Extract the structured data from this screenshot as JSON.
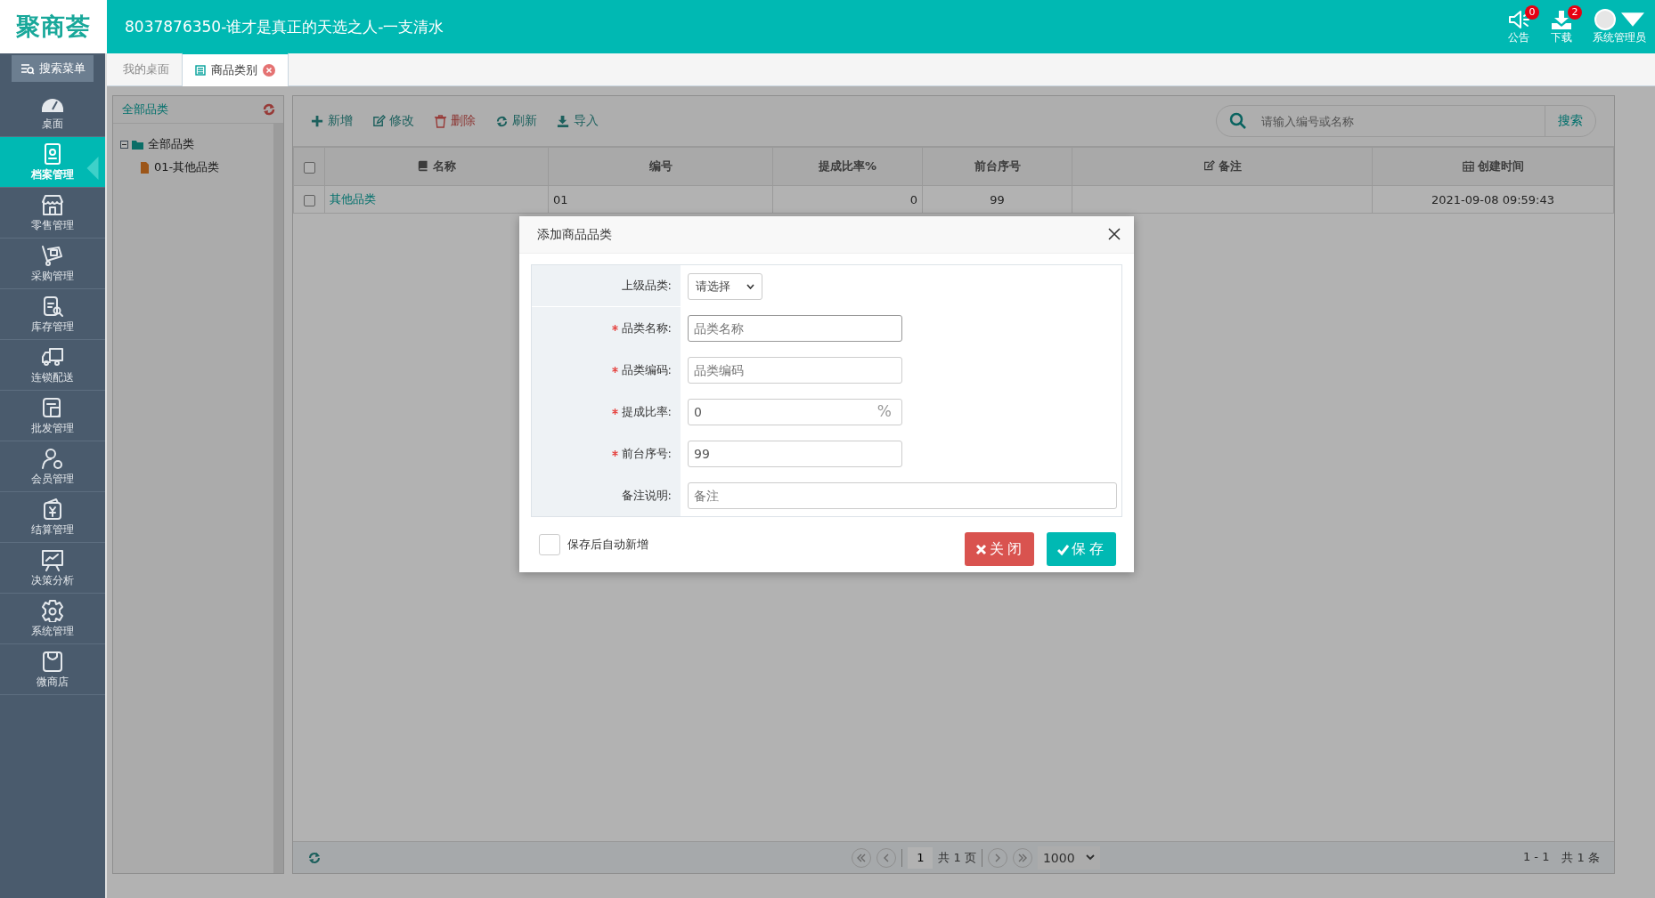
{
  "app": {
    "logo": "聚商荟",
    "title": "8037876350-谁才是真正的天选之人-一支清水"
  },
  "top_actions": [
    {
      "kind": "notice",
      "label": "公告",
      "badge": "0"
    },
    {
      "kind": "download",
      "label": "下载",
      "badge": "2"
    },
    {
      "kind": "user",
      "label": "系统管理员"
    }
  ],
  "sidebar": {
    "search": "搜索菜单",
    "items": [
      {
        "kind": "gauge",
        "label": "桌面",
        "selected": false
      },
      {
        "kind": "archive",
        "label": "档案管理",
        "selected": true
      },
      {
        "kind": "store",
        "label": "零售管理",
        "selected": false
      },
      {
        "kind": "cart",
        "label": "采购管理",
        "selected": false
      },
      {
        "kind": "stock",
        "label": "库存管理",
        "selected": false
      },
      {
        "kind": "truck",
        "label": "连锁配送",
        "selected": false
      },
      {
        "kind": "wholesale",
        "label": "批发管理",
        "selected": false
      },
      {
        "kind": "member",
        "label": "会员管理",
        "selected": false
      },
      {
        "kind": "wallet",
        "label": "结算管理",
        "selected": false
      },
      {
        "kind": "chart",
        "label": "决策分析",
        "selected": false
      },
      {
        "kind": "gear",
        "label": "系统管理",
        "selected": false
      },
      {
        "kind": "bag",
        "label": "微商店",
        "selected": false
      }
    ]
  },
  "tabs": [
    {
      "label": "我的桌面",
      "selected": false,
      "closable": false
    },
    {
      "label": "商品类别",
      "selected": true,
      "closable": true
    }
  ],
  "tree_panel": {
    "title": "全部品类",
    "tree": [
      {
        "label": "全部品类",
        "expanded": true,
        "children": [
          {
            "label": "01-其他品类"
          }
        ]
      }
    ]
  },
  "toolbar": [
    {
      "kind": "add",
      "label": "新增"
    },
    {
      "kind": "edit",
      "label": "修改"
    },
    {
      "kind": "delete",
      "label": "删除"
    },
    {
      "kind": "refresh",
      "label": "刷新"
    },
    {
      "kind": "import",
      "label": "导入"
    }
  ],
  "search": {
    "placeholder": "请输入编号或名称",
    "button": "搜索"
  },
  "table": {
    "select_all": false,
    "columns": [
      {
        "label": "名称"
      },
      {
        "label": "编号"
      },
      {
        "label": "提成比率%"
      },
      {
        "label": "前台序号"
      },
      {
        "label": "备注"
      },
      {
        "label": "创建时间"
      }
    ],
    "rows": [
      {
        "checked": false,
        "name": "其他品类",
        "code": "01",
        "rate": "0",
        "order": "99",
        "created": "2021-09-08 09:59:43"
      }
    ]
  },
  "pager": {
    "page": "1",
    "pages": "共 1 页",
    "page_size": "1000",
    "range": "1 - 1",
    "total": "共 1 条"
  },
  "dialog": {
    "title": "添加商品品类",
    "fields": [
      {
        "kind": "select",
        "label": "上级品类:",
        "required": false,
        "value": "请选择"
      },
      {
        "kind": "text",
        "label": "品类名称:",
        "required": true,
        "placeholder": "品类名称",
        "focused": true
      },
      {
        "kind": "text",
        "label": "品类编码:",
        "required": true,
        "placeholder": "品类编码",
        "focused": false
      },
      {
        "kind": "text",
        "label": "提成比率:",
        "required": true,
        "value": "0",
        "suffix": "%",
        "focused": false
      },
      {
        "kind": "text",
        "label": "前台序号:",
        "required": true,
        "value": "99",
        "focused": false
      },
      {
        "kind": "wide",
        "label": "备注说明:",
        "required": false,
        "placeholder": "备注",
        "focused": false
      }
    ],
    "auto_add": {
      "label": "保存后自动新增",
      "checked": false
    },
    "buttons": [
      {
        "kind": "close",
        "label": "关闭"
      },
      {
        "kind": "save",
        "label": "保存"
      }
    ]
  }
}
